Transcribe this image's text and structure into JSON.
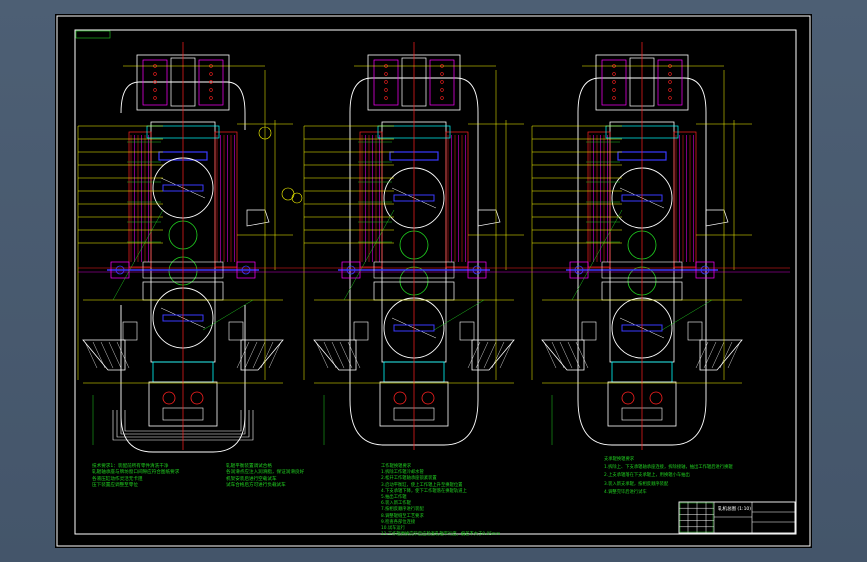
{
  "canvas": {
    "background": "#000000",
    "frame_color": "#ffffff",
    "window_bg": "#4a5a6e"
  },
  "colors": {
    "yellow": "#ffff00",
    "red": "#ff2020",
    "magenta": "#ff00ff",
    "cyan": "#00ffff",
    "green": "#21d321",
    "blue": "#3a3aff",
    "white": "#ffffff"
  },
  "notes": {
    "block1": [
      "技术要求1：装配前所有零件清洗干净",
      "轧辊轴承座与牌坊窗口间隙应符合图纸要求",
      "各液压缸动作灵活无卡阻",
      "压下装置应调整至零位"
    ],
    "block2": [
      "轧辊平衡装置调试合格",
      "各润滑点应注入润滑脂，保证润滑良好",
      "机架安装后进行空载试车",
      "试车合格后方可进行负载试车"
    ],
    "block3": [
      "工作辊换辊要求",
      "1.拆除工作辊冷却水管",
      "2.松开工作辊轴承座锁紧装置",
      "3.启动平衡缸，使上工作辊上升至换辊位置",
      "4.下支承辊下降，使下工作辊落在换辊轨道上",
      "5.抽出工作辊",
      "6.装入新工作辊",
      "7.按相反顺序进行装配",
      "8.调整辊缝至工艺要求",
      "9.检查各部位连接",
      "10.试车运行",
      "11.工作辊更换完毕后应检查轧辊平行度，偏差不大于0.05mm"
    ],
    "block4": [
      "支承辊换辊要求",
      "1.拆除上、下支承辊轴承座连接，拆除接轴，抽出工作辊后进行换辊",
      "2.上支承辊落在下支承辊上，用换辊小车抽出",
      "3.装入新支承辊，按相反顺序装配",
      "4.调整完毕后进行试车"
    ]
  },
  "title_block": {
    "name": "轧机总图 (1:10)"
  }
}
